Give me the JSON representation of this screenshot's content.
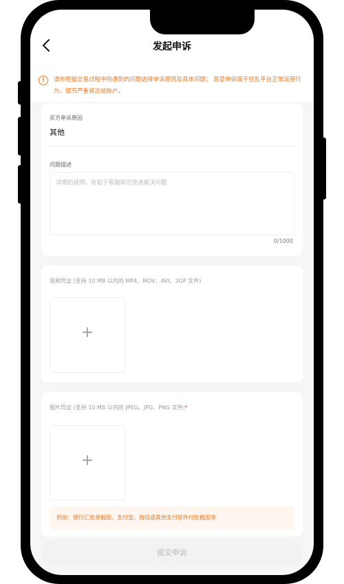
{
  "header": {
    "title": "发起申诉"
  },
  "warning": {
    "text": "请你根据交易过程中所遇到的问题选择申诉原因及具体问题； 恶意申诉属于扰乱平台正常运营行为，情节严重将冻结账户。"
  },
  "reason": {
    "label": "买方申诉原因",
    "value": "其他"
  },
  "description": {
    "label": "问题描述",
    "placeholder": "详细的说明，有助于客服帮您快速解决问题",
    "counter": "0/1000"
  },
  "video": {
    "label": "视频凭证 (支持 10 MB 以内的 MP4、MOV、AVI、3GP 文件)",
    "add_symbol": "+"
  },
  "image": {
    "label": "图片凭证 (支持 10 MB 以内的 JPEG、JPG、PNG 文件)",
    "required_mark": "*",
    "add_symbol": "+",
    "example": "例如：银行汇款单截图，支付宝、微信或其他支付软件付款截图等"
  },
  "footer": {
    "submit_label": "提交申诉"
  },
  "colors": {
    "accent": "#f07a22",
    "required": "#e23c3c",
    "background": "#f6f6f6",
    "disabled_button": "#f2f2f2"
  }
}
